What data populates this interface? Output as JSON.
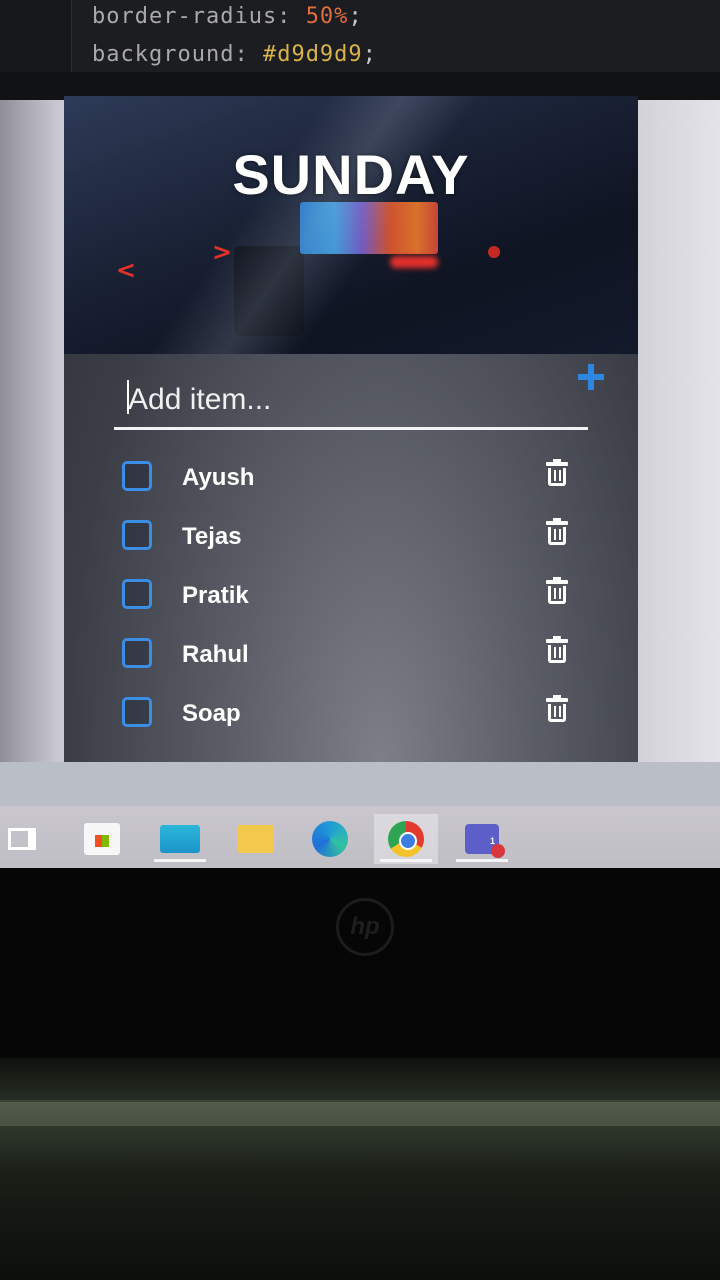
{
  "code_editor": {
    "line1_prop": "border-radius:",
    "line1_val": "50%",
    "line2_prop": "background:",
    "line2_val": "#d9d9d9",
    "semicolon": ";"
  },
  "app": {
    "title": "SUNDAY",
    "prev_symbol": "<",
    "next_symbol": ">",
    "add_placeholder": "Add item...",
    "add_button_icon": "plus-icon",
    "accent_color": "#2f86e0",
    "items": [
      {
        "label": "Ayush",
        "checked": false
      },
      {
        "label": "Tejas",
        "checked": false
      },
      {
        "label": "Pratik",
        "checked": false
      },
      {
        "label": "Rahul",
        "checked": false
      },
      {
        "label": "Soap",
        "checked": false
      }
    ]
  },
  "taskbar": {
    "apps": [
      "task-view-icon",
      "microsoft-store-icon",
      "mail-icon",
      "file-explorer-icon",
      "edge-icon",
      "chrome-icon",
      "teams-icon"
    ],
    "teams_badge": "1"
  },
  "laptop": {
    "brand": "hp"
  }
}
